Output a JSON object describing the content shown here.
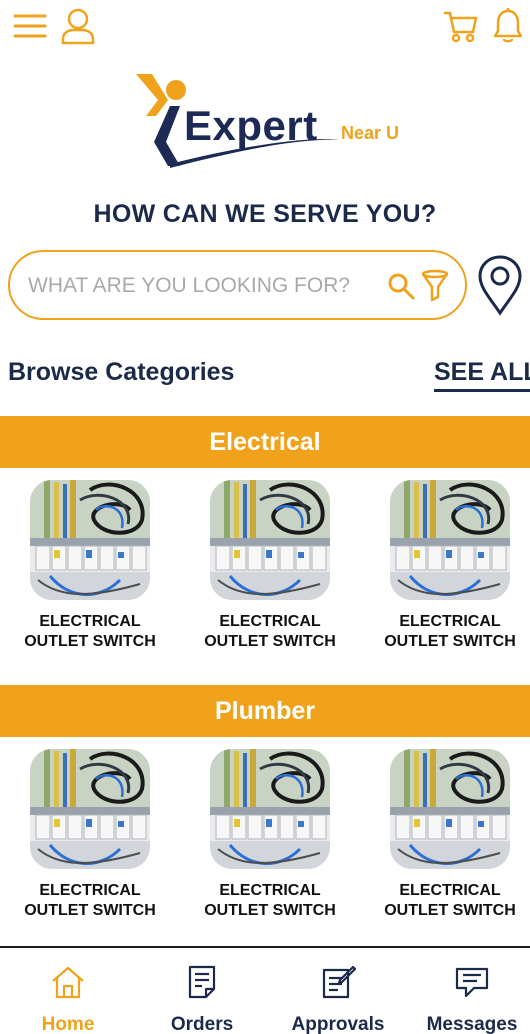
{
  "colors": {
    "accent": "#f0a21d",
    "navy": "#1c2a4a",
    "active_tab": "#f0a21d"
  },
  "topbar": {
    "icons": [
      "menu-icon",
      "user-icon",
      "cart-icon",
      "bell-icon"
    ]
  },
  "logo": {
    "word": "Expert",
    "sub": "Near U"
  },
  "headline": "HOW CAN WE SERVE YOU?",
  "search": {
    "placeholder": "WHAT ARE YOU LOOKING FOR?",
    "value": ""
  },
  "browse": {
    "title": "Browse Categories",
    "see_all": "SEE ALL"
  },
  "categories": [
    {
      "name": "Electrical",
      "items": [
        {
          "label": "ELECTRICAL OUTLET SWITCH"
        },
        {
          "label": "ELECTRICAL OUTLET SWITCH"
        },
        {
          "label": "ELECTRICAL OUTLET SWITCH"
        }
      ]
    },
    {
      "name": "Plumber",
      "items": [
        {
          "label": "ELECTRICAL OUTLET SWITCH"
        },
        {
          "label": "ELECTRICAL OUTLET SWITCH"
        },
        {
          "label": "ELECTRICAL OUTLET SWITCH"
        }
      ]
    }
  ],
  "bottom_nav": {
    "active": "Home",
    "items": [
      {
        "label": "Home",
        "icon": "home-icon"
      },
      {
        "label": "Orders",
        "icon": "orders-icon"
      },
      {
        "label": "Approvals",
        "icon": "approvals-icon"
      },
      {
        "label": "Messages",
        "icon": "messages-icon"
      }
    ]
  }
}
